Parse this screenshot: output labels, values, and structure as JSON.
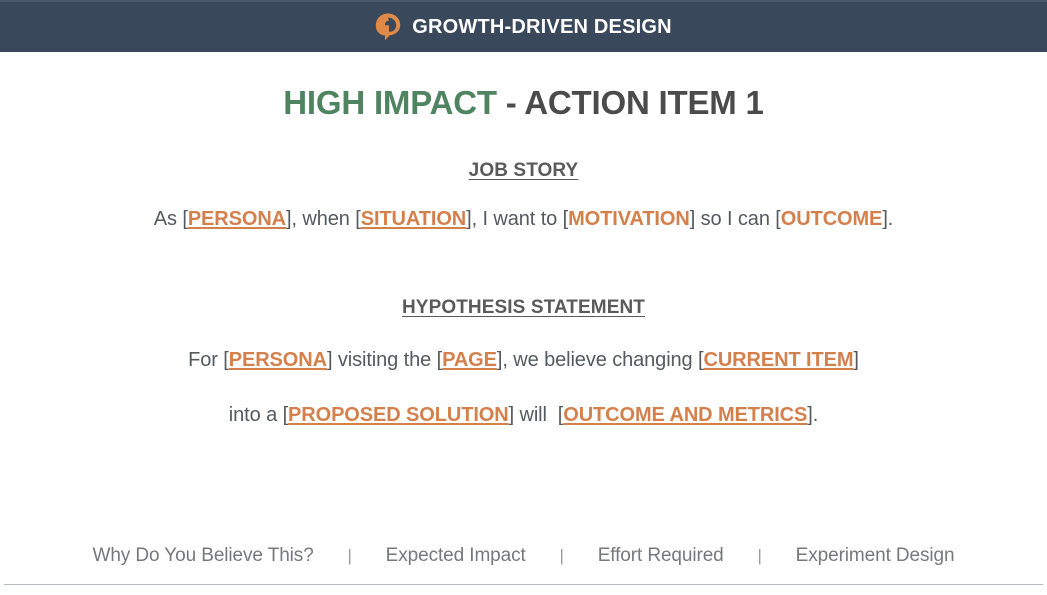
{
  "header": {
    "logo_icon": "gdd-swirl-logo-icon",
    "brand": "GROWTH-DRIVEN DESIGN",
    "bar_color": "#39485a",
    "logo_color": "#e08a47"
  },
  "title": {
    "impact_label": "HIGH IMPACT",
    "rest_label": " - ACTION ITEM 1",
    "impact_color": "#4f8461",
    "rest_color": "#4b4b4b"
  },
  "job_story": {
    "heading": "JOB STORY",
    "segments": [
      {
        "text": "As [",
        "type": "plain"
      },
      {
        "text": "PERSONA",
        "type": "placeholder",
        "underlined": true
      },
      {
        "text": "], when [",
        "type": "plain"
      },
      {
        "text": "SITUATION",
        "type": "placeholder",
        "underlined": true
      },
      {
        "text": "], I want to [",
        "type": "plain"
      },
      {
        "text": "MOTIVATION",
        "type": "placeholder",
        "underlined": false
      },
      {
        "text": "] so I can [",
        "type": "plain"
      },
      {
        "text": "OUTCOME",
        "type": "placeholder",
        "underlined": false
      },
      {
        "text": "].",
        "type": "plain"
      }
    ],
    "full_text": "As [PERSONA], when [SITUATION], I want to [MOTIVATION] so I can [OUTCOME]."
  },
  "hypothesis": {
    "heading": "HYPOTHESIS STATEMENT",
    "line1_segments": [
      {
        "text": "For [",
        "type": "plain"
      },
      {
        "text": "PERSONA",
        "type": "placeholder",
        "underlined": true
      },
      {
        "text": "] visiting the [",
        "type": "plain"
      },
      {
        "text": "PAGE",
        "type": "placeholder",
        "underlined": true
      },
      {
        "text": "], we believe changing [",
        "type": "plain"
      },
      {
        "text": "CURRENT ITEM",
        "type": "placeholder",
        "underlined": true
      },
      {
        "text": "]",
        "type": "plain"
      }
    ],
    "line2_segments": [
      {
        "text": "into a [",
        "type": "plain"
      },
      {
        "text": "PROPOSED SOLUTION",
        "type": "placeholder",
        "underlined": true
      },
      {
        "text": "] will  [",
        "type": "plain"
      },
      {
        "text": "OUTCOME AND METRICS",
        "type": "placeholder",
        "underlined": true
      },
      {
        "text": "].",
        "type": "plain"
      }
    ],
    "line1_text": "For [PERSONA] visiting the [PAGE], we believe changing [CURRENT ITEM]",
    "line2_text": "into a [PROPOSED SOLUTION] will  [OUTCOME AND METRICS]."
  },
  "footer": {
    "separator": "|",
    "links": [
      {
        "label": "Why Do You Believe This?"
      },
      {
        "label": "Expected Impact"
      },
      {
        "label": "Effort Required"
      },
      {
        "label": "Experiment Design"
      }
    ]
  },
  "colors": {
    "placeholder_orange": "#d4804c",
    "body_gray": "#555a5e",
    "heading_gray": "#5a5a5a",
    "footer_gray": "#76787a",
    "rule_gray": "#b7bcc2"
  }
}
